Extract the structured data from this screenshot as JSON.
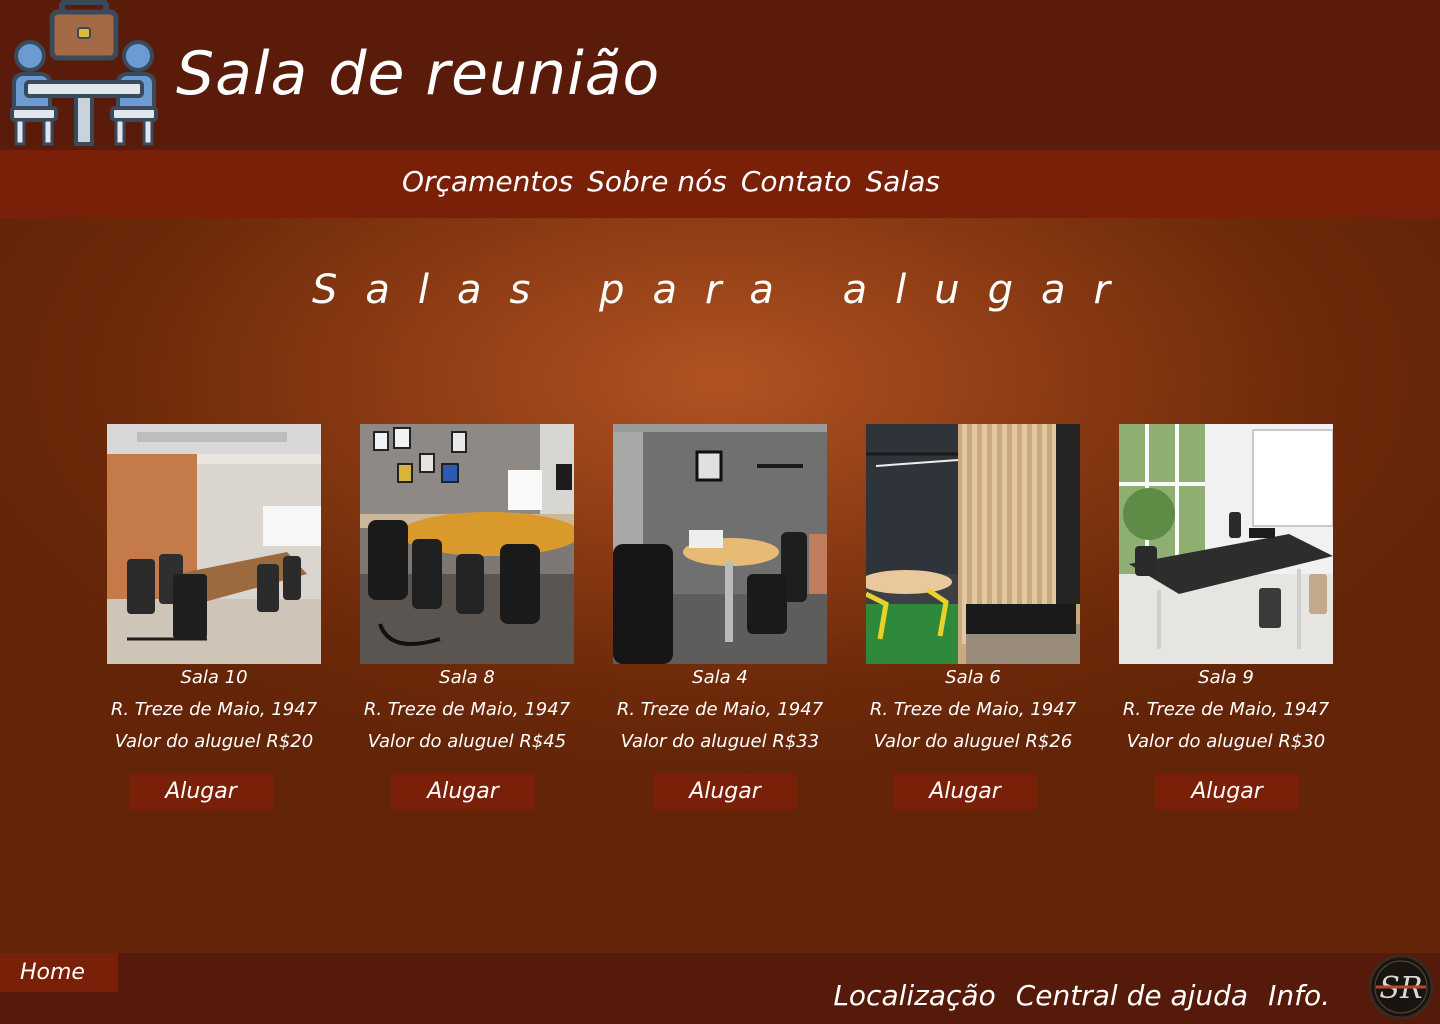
{
  "header": {
    "title": "Sala de reunião",
    "logo_icon": "meeting-room-icon"
  },
  "nav": {
    "items": [
      {
        "label": "Orçamentos"
      },
      {
        "label": "Sobre nós"
      },
      {
        "label": "Contato"
      },
      {
        "label": "Salas"
      }
    ]
  },
  "main": {
    "heading": "Salas para alugar",
    "rooms": [
      {
        "name": "Sala 10",
        "address": "R. Treze de Maio, 1947",
        "price": "Valor do aluguel R$20",
        "button": "Alugar"
      },
      {
        "name": "Sala 8",
        "address": "R. Treze de Maio, 1947",
        "price": "Valor do aluguel R$45",
        "button": "Alugar"
      },
      {
        "name": "Sala 4",
        "address": "R. Treze de Maio, 1947",
        "price": "Valor do aluguel R$33",
        "button": "Alugar"
      },
      {
        "name": "Sala 6",
        "address": "R. Treze de Maio, 1947",
        "price": "Valor do aluguel R$26",
        "button": "Alugar"
      },
      {
        "name": "Sala 9",
        "address": "R. Treze de Maio, 1947",
        "price": "Valor do aluguel R$30",
        "button": "Alugar"
      }
    ]
  },
  "footer": {
    "home": "Home",
    "links": [
      {
        "label": "Localização"
      },
      {
        "label": "Central de ajuda"
      },
      {
        "label": "Info."
      }
    ],
    "logo_text": "SR"
  },
  "colors": {
    "header_bg": "#5a1b0a",
    "nav_bg": "#7a1f08",
    "main_bg_center": "#b05322",
    "main_bg_edge": "#632408",
    "footer_bg": "#561a0a",
    "text": "#ffffff"
  }
}
